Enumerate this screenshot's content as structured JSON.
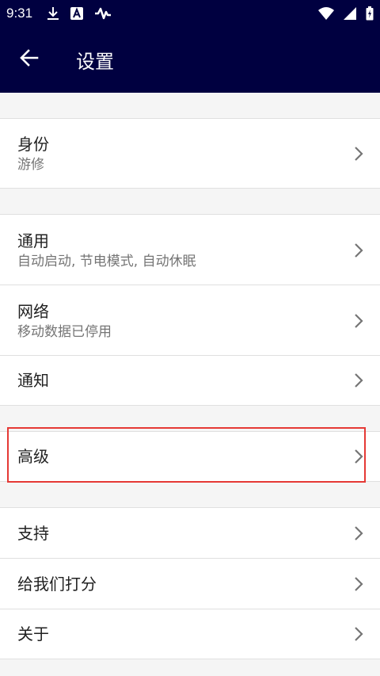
{
  "status_bar": {
    "time": "9:31",
    "left_icons": [
      "download-icon",
      "a-badge-icon",
      "signal-activity-icon"
    ],
    "right_icons": [
      "wifi-icon",
      "cell-signal-icon",
      "battery-charging-icon"
    ]
  },
  "app_bar": {
    "back_icon": "arrow-back-icon",
    "title": "设置"
  },
  "groups": {
    "identity": {
      "title": "身份",
      "subtitle": "游修"
    },
    "general": {
      "title": "通用",
      "subtitle": "自动启动, 节电模式, 自动休眠"
    },
    "network": {
      "title": "网络",
      "subtitle": "移动数据已停用"
    },
    "notifications": {
      "title": "通知"
    },
    "advanced": {
      "title": "高级"
    },
    "support": {
      "title": "支持"
    },
    "rate": {
      "title": "给我们打分"
    },
    "about": {
      "title": "关于"
    }
  },
  "colors": {
    "app_bar_bg": "#000040",
    "page_bg": "#f5f5f5",
    "highlight_border": "#e53935"
  }
}
